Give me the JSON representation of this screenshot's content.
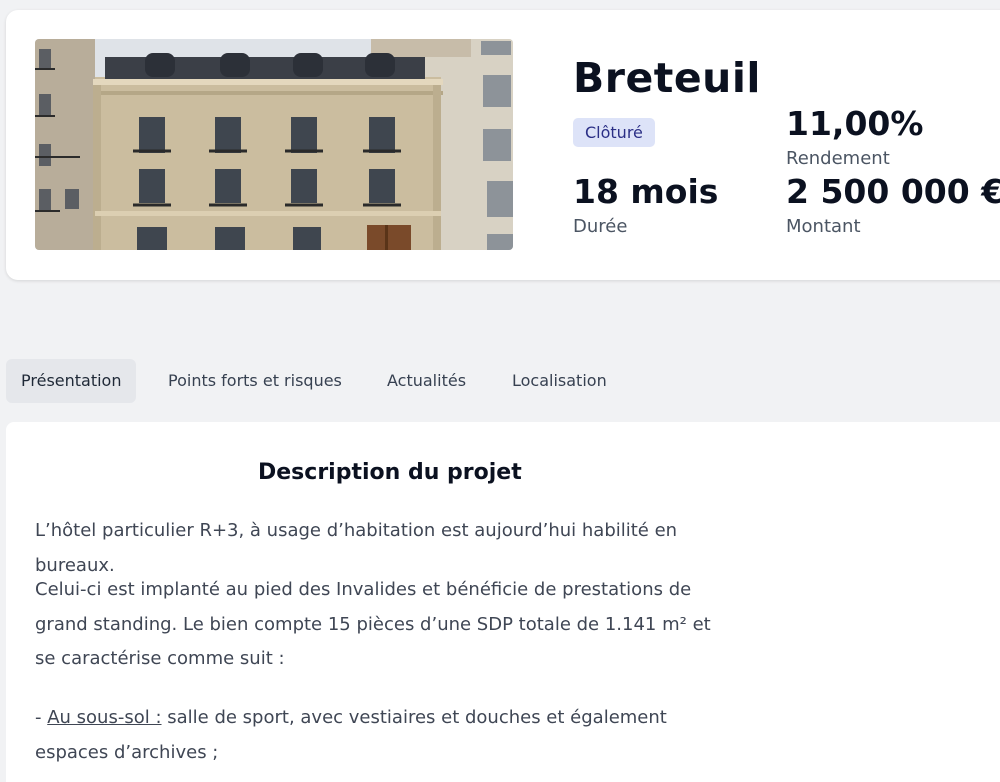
{
  "project": {
    "title": "Breteuil",
    "status": "Clôturé",
    "yield": {
      "value": "11,00%",
      "label": "Rendement"
    },
    "duration": {
      "value": "18 mois",
      "label": "Durée"
    },
    "amount": {
      "value": "2 500 000 €",
      "label": "Montant"
    }
  },
  "tabs": [
    {
      "label": "Présentation",
      "active": true
    },
    {
      "label": "Points forts et risques"
    },
    {
      "label": "Actualités"
    },
    {
      "label": "Localisation"
    }
  ],
  "description": {
    "title": "Description du projet",
    "paragraphs": [
      "L’hôtel particulier R+3, à usage d’habitation est aujourd’hui habilité en bureaux.",
      "Celui-ci est implanté au pied des Invalides et bénéficie de prestations de grand standing. Le bien compte 15 pièces d’une SDP totale de 1.141 m² et se caractérise comme suit :"
    ],
    "list": [
      {
        "prefix": "- ",
        "label": "Au sous-sol :",
        "text": " salle de sport, avec vestiaires et douches et également espaces d’archives ;"
      }
    ]
  },
  "colors": {
    "badge_bg": "#dde3f8",
    "badge_text": "#2b2f86",
    "active_tab_bg": "#e5e7eb",
    "page_bg": "#f1f2f4"
  },
  "icons": {
    "photo": "building-facade-image"
  }
}
